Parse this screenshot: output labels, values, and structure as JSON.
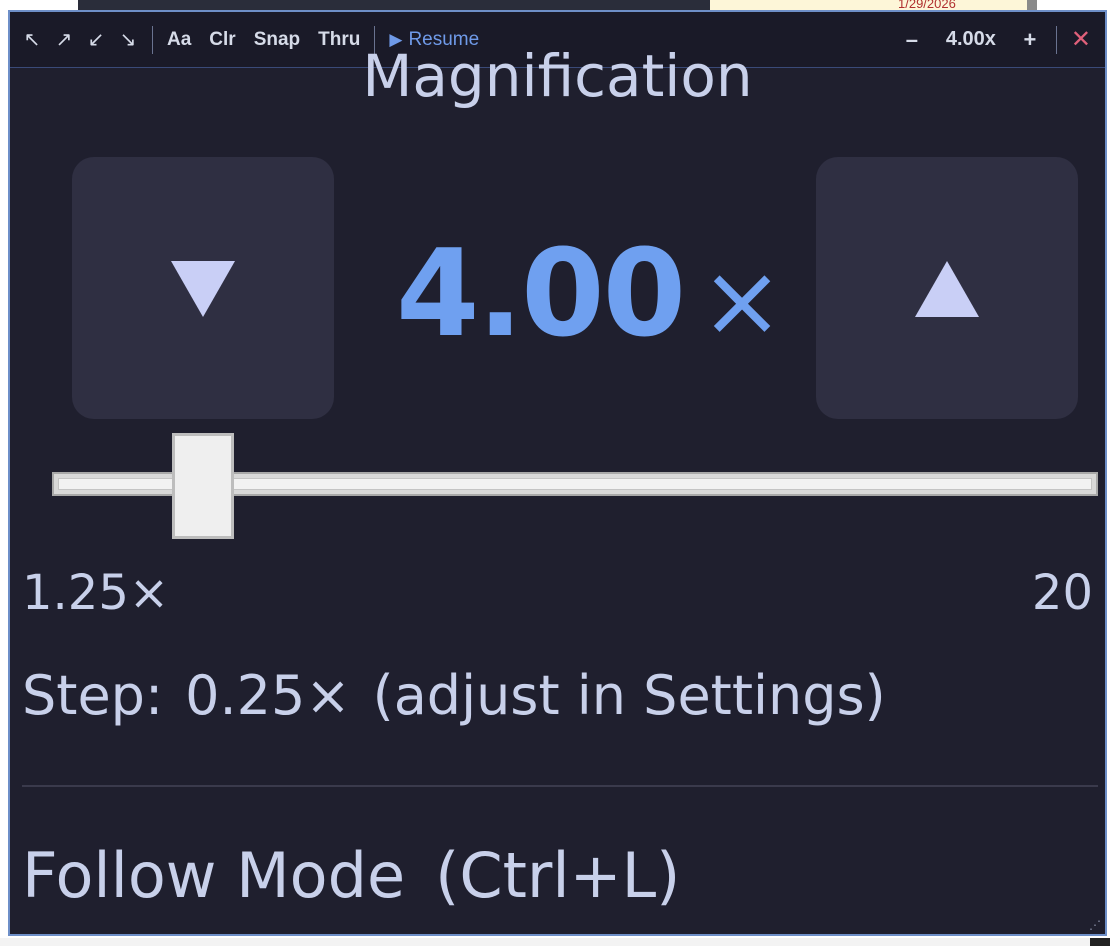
{
  "background": {
    "date": "1/29/2026"
  },
  "toolbar": {
    "arrows": [
      "↖",
      "↗",
      "↙",
      "↘"
    ],
    "text_size": "Aa",
    "clear": "Clr",
    "snap": "Snap",
    "thru": "Thru",
    "resume_icon": "▶",
    "resume": "Resume",
    "zoom_out": "–",
    "zoom_level": "4.00x",
    "zoom_in": "+",
    "close": "✕"
  },
  "panel": {
    "heading": "Magnification",
    "value": "4.00",
    "value_unit": "×",
    "decrease_icon": "triangle-down",
    "increase_icon": "triangle-up",
    "slider": {
      "min": 1.25,
      "max": 20,
      "value": 4.0
    },
    "range_min_label": "1.25×",
    "range_max_label": "20",
    "step_label": "Step:",
    "step_value": "0.25×",
    "step_hint": "(adjust in Settings)",
    "follow_label": "Follow Mode",
    "follow_shortcut": "(Ctrl+L)"
  },
  "colors": {
    "accent": "#6fa0f0",
    "window_bg": "#1f1f2e",
    "button_bg": "#2f2f42",
    "close": "#e0607a",
    "border": "#6e8fc8"
  }
}
